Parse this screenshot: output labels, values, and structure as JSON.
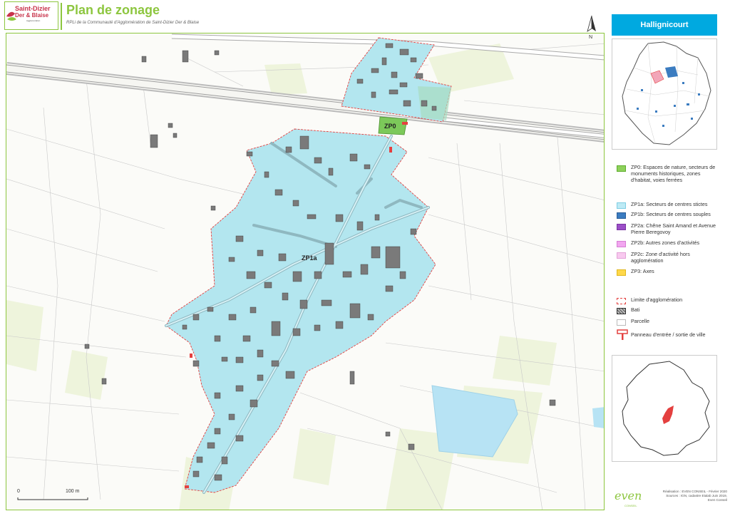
{
  "header": {
    "logo_line1": "Saint-Dizier",
    "logo_line2": "Der & Blaise",
    "logo_line3": "Agglomération",
    "title": "Plan de zonage",
    "subtitle": "RPLi de la Communauté d'Agglomération de Saint-Dizier Der & Blaise"
  },
  "north_label": "N",
  "commune": "Hallignicourt",
  "map_labels": {
    "zp0": "ZP0",
    "zp1a": "ZP1a"
  },
  "legend": {
    "zones": [
      {
        "color": "#8ed15b",
        "border": "#5fae2e",
        "text": "ZP0: Espaces de nature, secteurs de monuments historiques, zones d'habitat, voies ferrées"
      },
      {
        "color": "#bdeaf5",
        "border": "#7fcde3",
        "text": "ZP1a: Secteurs de centres stictes"
      },
      {
        "color": "#3b7cc0",
        "border": "#2a5e99",
        "text": "ZP1b: Secteurs de centres souples"
      },
      {
        "color": "#9b4fc7",
        "border": "#7a35a3",
        "text": "ZP2a: Chêne Saint Amand et Avenue Pierre Beregovoy"
      },
      {
        "color": "#f2a6f0",
        "border": "#d57fd3",
        "text": "ZP2b: Autres zones d'activités"
      },
      {
        "color": "#f8c9ef",
        "border": "#e3a3d8",
        "text": "ZP2c: Zone d'activité hors agglomération"
      },
      {
        "color": "#ffd84a",
        "border": "#e0b71e",
        "text": "ZP3: Axes"
      }
    ],
    "others": [
      {
        "kind": "limit",
        "text": "Limite d'agglomération"
      },
      {
        "kind": "bati",
        "text": "Bati"
      },
      {
        "kind": "parcelle",
        "text": "Parcelle"
      },
      {
        "kind": "panneau",
        "text": "Panneau d'entrée / sortie de ville"
      }
    ]
  },
  "scale": {
    "zero": "0",
    "hundred": "100 m"
  },
  "footer": {
    "brand": "even",
    "brand_sub": "CONSEIL",
    "credits_1": "Réalisation : EVEN CONSEIL - Février 2020",
    "credits_2": "Sources : IGN, cadastre Etalab Juin 2019,",
    "credits_3": "Even Conseil"
  },
  "colors": {
    "accent": "#8dc63f",
    "zone_zp1a": "#b3e6ef",
    "zone_zp0": "#7cc95a",
    "limit": "#e4403f",
    "commune_box": "#00a9e0"
  }
}
